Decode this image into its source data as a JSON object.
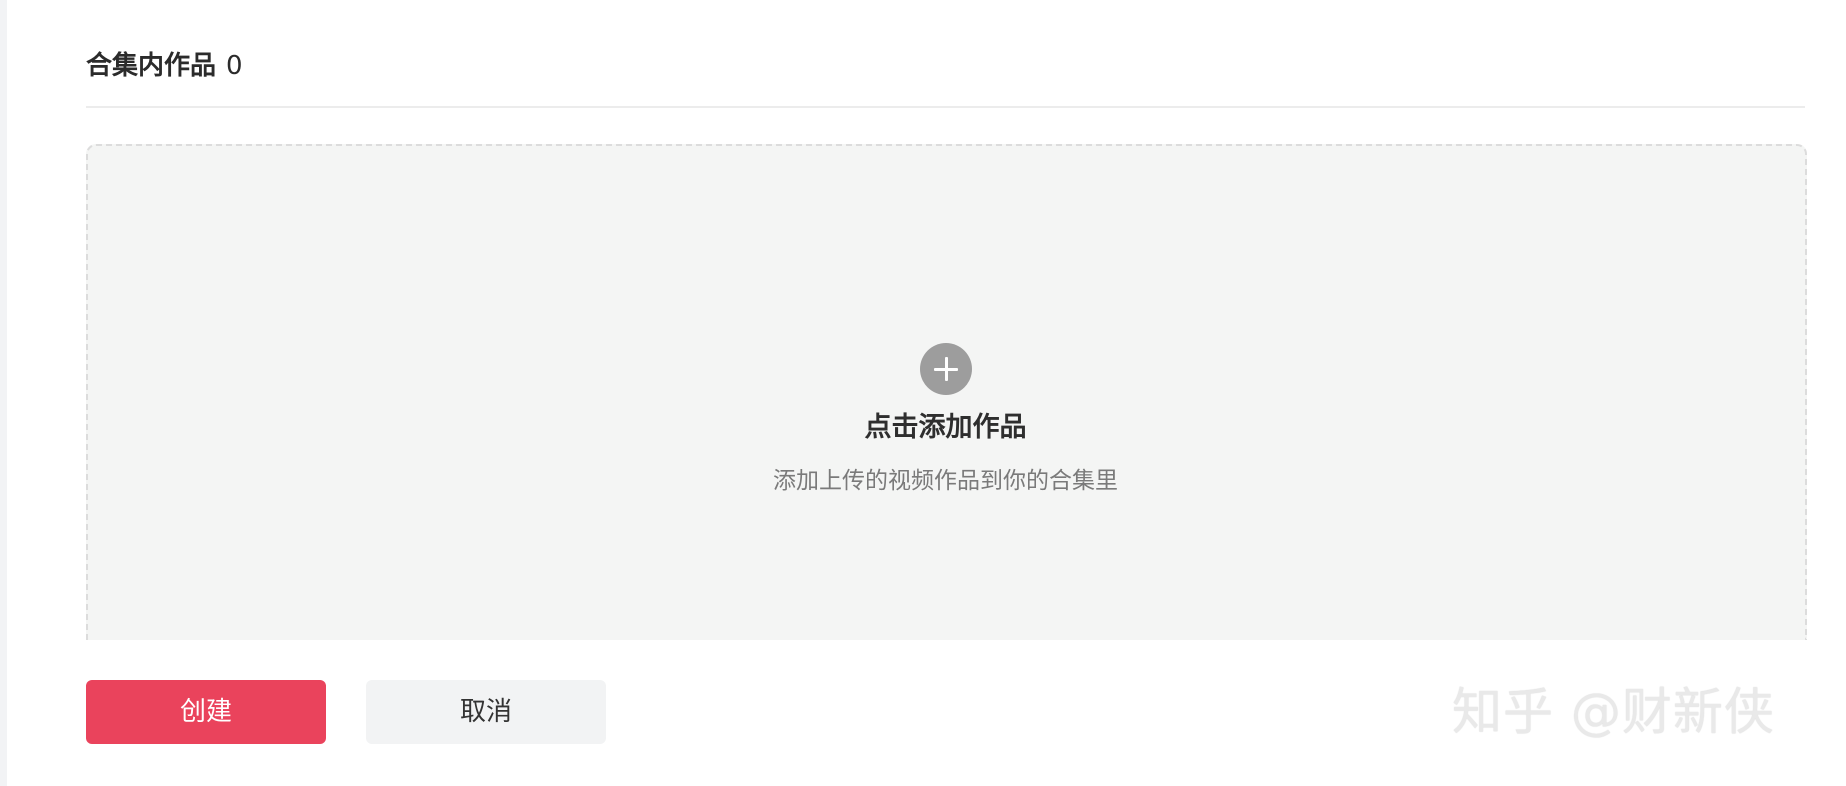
{
  "collection": {
    "title": "合集内作品",
    "count": "0"
  },
  "dropzone": {
    "icon": "plus-circle-icon",
    "title": "点击添加作品",
    "subtitle": "添加上传的视频作品到你的合集里"
  },
  "actions": {
    "create_label": "创建",
    "cancel_label": "取消"
  },
  "watermark": {
    "text": "知乎 @财新侠"
  },
  "colors": {
    "primary": "#ea435c",
    "dropzone_bg": "#f4f5f4",
    "icon_bg": "#9d9d9d"
  }
}
